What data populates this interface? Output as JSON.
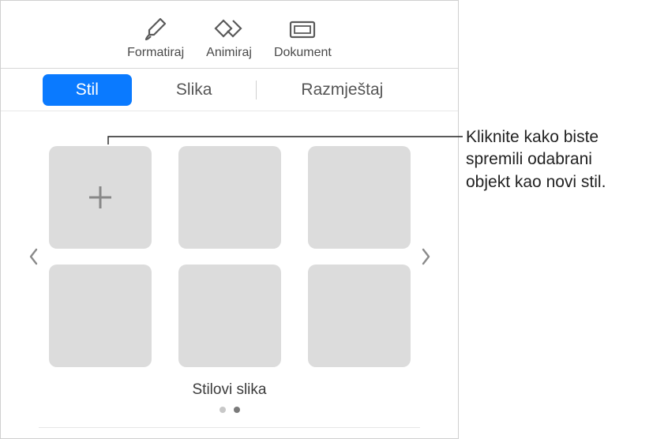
{
  "toolbar": {
    "format": {
      "label": "Formatiraj",
      "icon": "paintbrush-icon"
    },
    "animate": {
      "label": "Animiraj",
      "icon": "diamond-icon"
    },
    "document": {
      "label": "Dokument",
      "icon": "document-icon"
    }
  },
  "tabs": {
    "style": "Stil",
    "image": "Slika",
    "layout": "Razmještaj"
  },
  "styles": {
    "caption": "Stilovi slika"
  },
  "callout": {
    "text": "Kliknite kako biste spremili odabrani objekt kao novi stil."
  }
}
